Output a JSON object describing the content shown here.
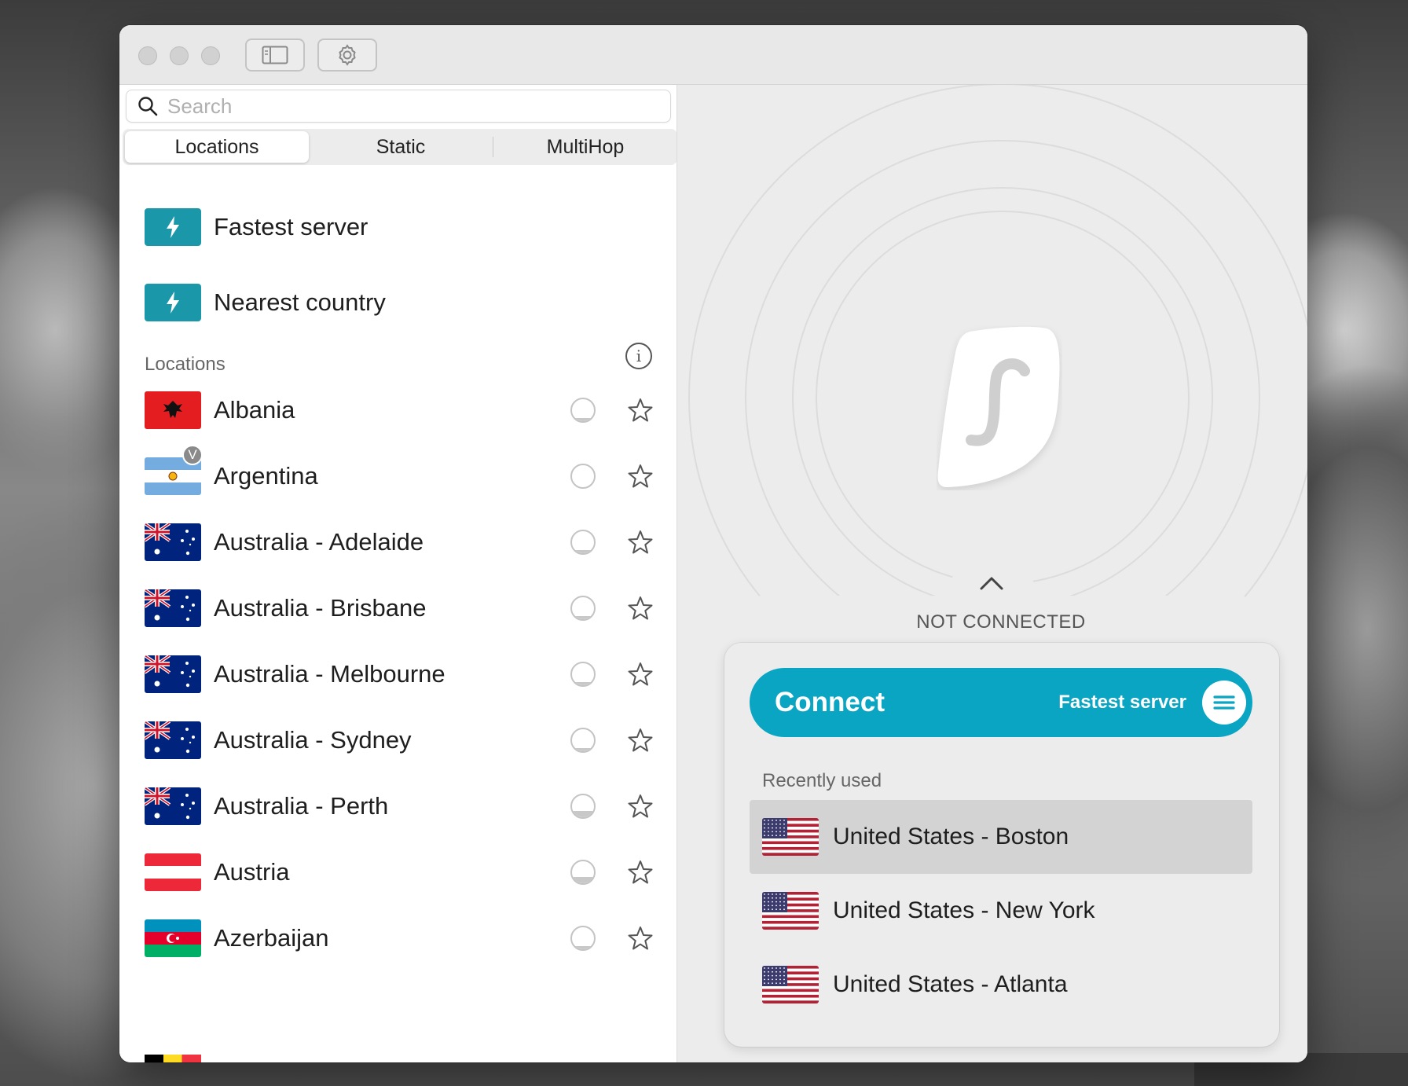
{
  "toolbar": {
    "sidebar_icon": "sidebar-toggle-icon",
    "settings_icon": "gear-icon"
  },
  "search": {
    "placeholder": "Search",
    "value": ""
  },
  "tabs": [
    {
      "label": "Locations",
      "active": true
    },
    {
      "label": "Static",
      "active": false
    },
    {
      "label": "MultiHop",
      "active": false
    }
  ],
  "quick": {
    "fastest": "Fastest server",
    "nearest": "Nearest country"
  },
  "locations_section": {
    "title": "Locations"
  },
  "locations": [
    {
      "name": "Albania",
      "flag": "albania",
      "load": 0.15
    },
    {
      "name": "Argentina",
      "flag": "argentina",
      "load": 0.0,
      "badge": "V"
    },
    {
      "name": "Australia - Adelaide",
      "flag": "australia",
      "load": 0.15
    },
    {
      "name": "Australia - Brisbane",
      "flag": "australia",
      "load": 0.15
    },
    {
      "name": "Australia - Melbourne",
      "flag": "australia",
      "load": 0.15
    },
    {
      "name": "Australia - Sydney",
      "flag": "australia",
      "load": 0.15
    },
    {
      "name": "Australia - Perth",
      "flag": "australia",
      "load": 0.3
    },
    {
      "name": "Austria",
      "flag": "austria",
      "load": 0.3
    },
    {
      "name": "Azerbaijan",
      "flag": "azerbaijan",
      "load": 0.15
    }
  ],
  "status": {
    "text": "NOT CONNECTED"
  },
  "connect": {
    "label": "Connect",
    "server": "Fastest server"
  },
  "recent": {
    "title": "Recently used",
    "items": [
      {
        "name": "United States - Boston",
        "selected": true
      },
      {
        "name": "United States - New York",
        "selected": false
      },
      {
        "name": "United States - Atlanta",
        "selected": false
      }
    ]
  },
  "colors": {
    "accent": "#0aa5c3",
    "bolt_box": "#1a98aa",
    "selected_row": "#d3d3d3"
  }
}
